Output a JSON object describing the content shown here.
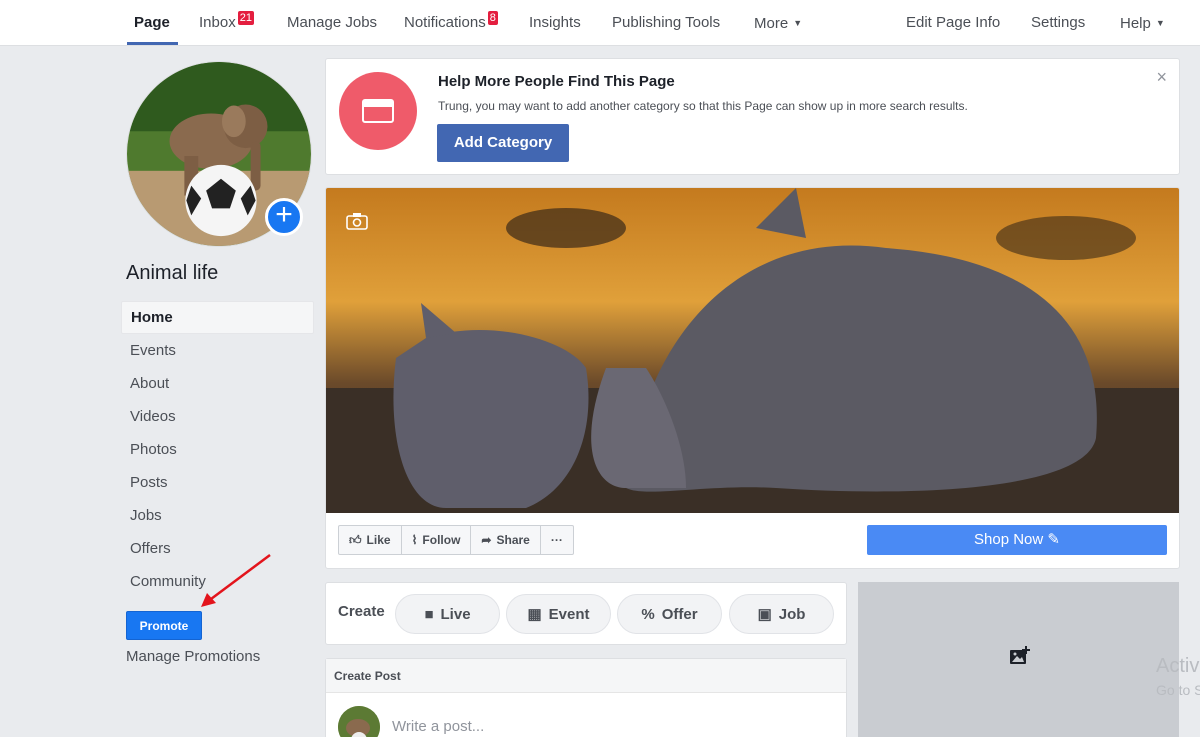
{
  "topnav": {
    "tabs": [
      {
        "label": "Page"
      },
      {
        "label": "Inbox",
        "badge": "21"
      },
      {
        "label": "Manage Jobs"
      },
      {
        "label": "Notifications",
        "badge": "8"
      },
      {
        "label": "Insights"
      },
      {
        "label": "Publishing Tools"
      },
      {
        "label": "More"
      },
      {
        "label": "Edit Page Info"
      },
      {
        "label": "Settings"
      },
      {
        "label": "Help"
      }
    ],
    "accent_color": "#4267b2",
    "badge_color": "#e41e3f"
  },
  "page": {
    "name": "Animal life"
  },
  "sidebar": {
    "items": [
      {
        "label": "Home"
      },
      {
        "label": "Events"
      },
      {
        "label": "About"
      },
      {
        "label": "Videos"
      },
      {
        "label": "Photos"
      },
      {
        "label": "Posts"
      },
      {
        "label": "Jobs"
      },
      {
        "label": "Offers"
      },
      {
        "label": "Community"
      }
    ],
    "promote_label": "Promote",
    "manage_promotions_label": "Manage Promotions"
  },
  "help_card": {
    "title": "Help More People Find This Page",
    "description": "Trung, you may want to add another category so that this Page can show up in more search results.",
    "button_label": "Add Category",
    "close_glyph": "×"
  },
  "cover": {
    "actions": [
      {
        "label": "Like",
        "icon": "thumbs-up-icon"
      },
      {
        "label": "Follow",
        "icon": "rss-icon"
      },
      {
        "label": "Share",
        "icon": "share-arrow-icon"
      },
      {
        "label": "···",
        "icon": "more-dots-icon"
      }
    ],
    "shop_now_label": "Shop Now"
  },
  "create": {
    "label": "Create",
    "options": [
      {
        "label": "Live",
        "icon": "video-camera-icon"
      },
      {
        "label": "Event",
        "icon": "calendar-icon"
      },
      {
        "label": "Offer",
        "icon": "tag-icon"
      },
      {
        "label": "Job",
        "icon": "briefcase-icon"
      }
    ]
  },
  "post": {
    "header": "Create Post",
    "placeholder": "Write a post..."
  },
  "watermark": {
    "line1": "Activ",
    "line2": "Go to S"
  }
}
